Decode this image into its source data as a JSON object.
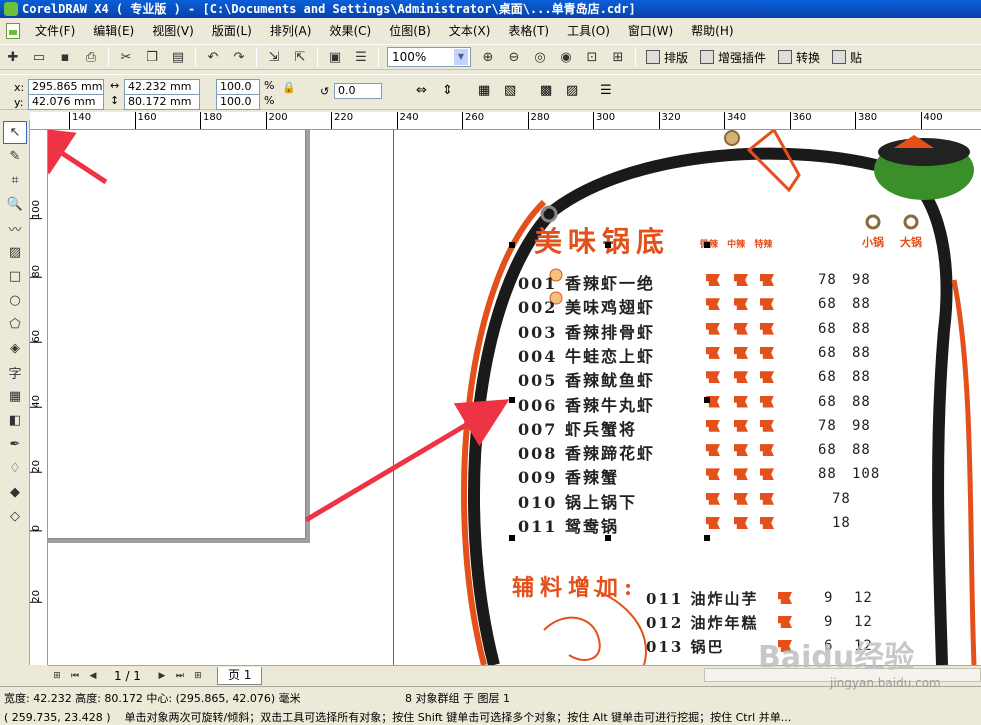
{
  "window": {
    "title": "CorelDRAW X4 ( 专业版 ) - [C:\\Documents and Settings\\Administrator\\桌面\\...单青岛店.cdr]"
  },
  "menubar": {
    "items": [
      "文件(F)",
      "编辑(E)",
      "视图(V)",
      "版面(L)",
      "排列(A)",
      "效果(C)",
      "位图(B)",
      "文本(X)",
      "表格(T)",
      "工具(O)",
      "窗口(W)",
      "帮助(H)"
    ]
  },
  "toolbar": {
    "zoom": "100%",
    "btn_layout": "排版",
    "btn_plugin": "增强插件",
    "btn_convert": "转换",
    "btn_paste": "贴"
  },
  "property_bar": {
    "x_label": "x:",
    "y_label": "y:",
    "x_value": "295.865 mm",
    "y_value": "42.076 mm",
    "w_value": "42.232 mm",
    "h_value": "80.172 mm",
    "scale_x": "100.0",
    "scale_y": "100.0",
    "percent": "%",
    "rotation": "0.0"
  },
  "ruler": {
    "h_ticks": [
      "140",
      "160",
      "180",
      "200",
      "220",
      "240",
      "260",
      "280",
      "300",
      "320",
      "340",
      "360",
      "380",
      "400"
    ],
    "v_ticks": [
      "100",
      "80",
      "60",
      "40",
      "20",
      "0",
      "20"
    ]
  },
  "menu_card": {
    "title": "美味锅底",
    "levels": [
      "微辣",
      "中辣",
      "特辣"
    ],
    "size_small": "小锅",
    "size_large": "大锅",
    "dishes": [
      {
        "name": "001 香辣虾一绝",
        "small": "78",
        "large": "98"
      },
      {
        "name": "002 美味鸡翅虾",
        "small": "68",
        "large": "88"
      },
      {
        "name": "003 香辣排骨虾",
        "small": "68",
        "large": "88"
      },
      {
        "name": "004 牛蛙恋上虾",
        "small": "68",
        "large": "88"
      },
      {
        "name": "005 香辣鱿鱼虾",
        "small": "68",
        "large": "88"
      },
      {
        "name": "006 香辣牛丸虾",
        "small": "68",
        "large": "88"
      },
      {
        "name": "007 虾兵蟹将",
        "small": "78",
        "large": "98"
      },
      {
        "name": "008 香辣蹄花虾",
        "small": "68",
        "large": "88"
      },
      {
        "name": "009 香辣蟹",
        "small": "88",
        "large": "108"
      },
      {
        "name": "010 锅上锅下",
        "small": "78",
        "large": ""
      },
      {
        "name": "011 鸳鸯锅",
        "small": "18",
        "large": ""
      }
    ],
    "side_title": "辅料增加:",
    "sides": [
      {
        "name": "011 油炸山芋",
        "small": "9",
        "large": "12"
      },
      {
        "name": "012 油炸年糕",
        "small": "9",
        "large": "12"
      },
      {
        "name": "013 锅巴",
        "small": "6",
        "large": "12"
      }
    ]
  },
  "page_nav": {
    "count": "1 / 1",
    "tab": "页 1"
  },
  "status": {
    "dimensions": "宽度: 42.232 高度: 80.172 中心: (295.865, 42.076) 毫米",
    "selection": "8 对象群组 于 图层 1",
    "cursor": "( 259.735, 23.428 )",
    "hint": "单击对象两次可旋转/倾斜；双击工具可选择所有对象；按住 Shift 键单击可选择多个对象；按住 Alt 键单击可进行挖掘；按住 Ctrl 并单..."
  },
  "watermark": {
    "brand": "Baidu经验",
    "url": "jingyan.baidu.com"
  },
  "colors": {
    "accent": "#e4501a",
    "titlebar": "#0a5fd8",
    "chrome": "#ece9d8",
    "arrow": "#ee3344"
  }
}
